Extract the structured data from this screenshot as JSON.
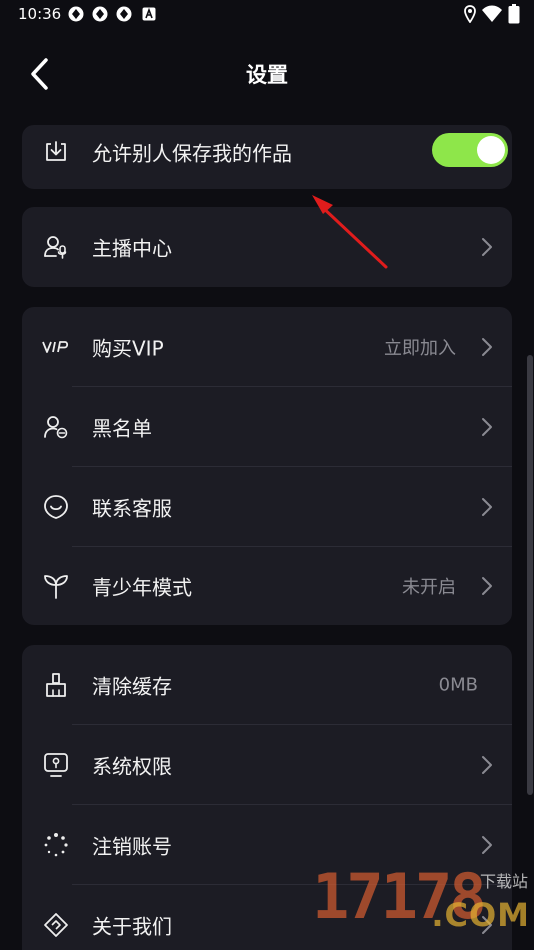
{
  "status_bar": {
    "time": "10:36",
    "icons": [
      "app-notification-icon",
      "app-notification-icon",
      "app-notification-icon",
      "a-notification-icon",
      "location-icon",
      "wifi-icon",
      "battery-icon"
    ]
  },
  "header": {
    "title": "设置",
    "back_icon": "back-chevron-icon"
  },
  "cards": [
    {
      "rows": [
        {
          "icon": "download-icon",
          "label": "允许别人保存我的作品",
          "toggle": true
        }
      ]
    },
    {
      "rows": [
        {
          "icon": "anchor-center-icon",
          "label": "主播中心",
          "chevron": true
        }
      ]
    },
    {
      "rows": [
        {
          "icon": "vip-icon",
          "label": "购买VIP",
          "value": "立即加入",
          "chevron": true
        },
        {
          "icon": "blocklist-icon",
          "label": "黑名单",
          "chevron": true
        },
        {
          "icon": "customer-service-icon",
          "label": "联系客服",
          "chevron": true
        },
        {
          "icon": "sprout-icon",
          "label": "青少年模式",
          "value": "未开启",
          "chevron": true
        }
      ]
    },
    {
      "rows": [
        {
          "icon": "broom-icon",
          "label": "清除缓存",
          "value": "0MB"
        },
        {
          "icon": "system-permission-icon",
          "label": "系统权限",
          "chevron": true
        },
        {
          "icon": "loading-dots-icon",
          "label": "注销账号",
          "chevron": true
        },
        {
          "icon": "about-icon",
          "label": "关于我们",
          "chevron": true
        }
      ]
    }
  ],
  "watermark": {
    "number": "17178",
    "small": "下载站",
    "com": ".COM"
  },
  "colors": {
    "background": "#0d0d12",
    "card": "#1c1c24",
    "toggle_on": "#8ee64a",
    "annotation_arrow": "#e01c1c",
    "value_text": "#8a8a92"
  }
}
